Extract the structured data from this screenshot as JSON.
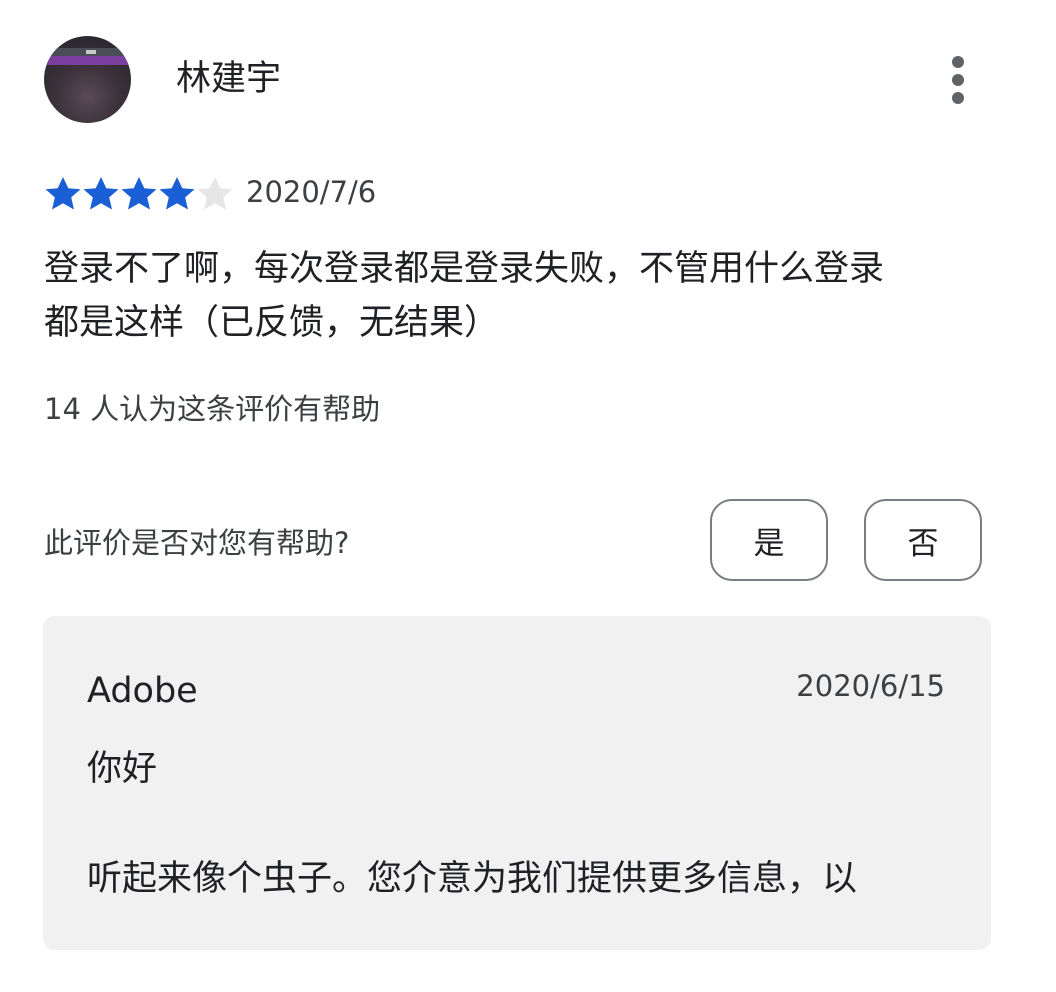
{
  "review": {
    "reviewer_name": "林建宇",
    "rating": 4,
    "rating_max": 5,
    "date": "2020/7/6",
    "text": "登录不了啊，每次登录都是登录失败，不管用什么登录\n都是这样（已反馈，无结果）",
    "helpful_count_text": "14 人认为这条评价有帮助",
    "more_icon": "more-vert-icon"
  },
  "feedback": {
    "prompt": "此评价是否对您有帮助?",
    "yes_label": "是",
    "no_label": "否"
  },
  "developer_reply": {
    "developer": "Adobe",
    "date": "2020/6/15",
    "greeting": "你好",
    "body": "听起来像个虫子。您介意为我们提供更多信息，以"
  },
  "colors": {
    "star_filled": "#1a5fd6",
    "star_empty": "#e6e6e6",
    "card_background": "#f1f1f1"
  }
}
